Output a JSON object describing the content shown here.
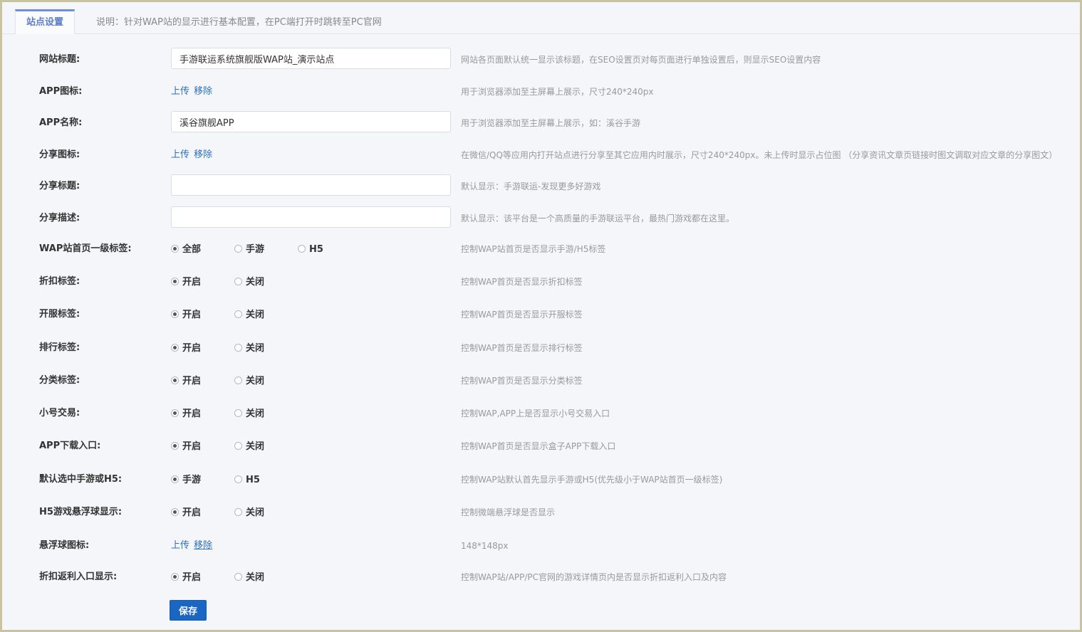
{
  "tab": {
    "label": "站点设置",
    "note": "说明：针对WAP站的显示进行基本配置，在PC端打开时跳转至PC官网"
  },
  "fields": {
    "site_title": {
      "label": "网站标题:",
      "value": "手游联运系统旗舰版WAP站_演示站点",
      "hint": "网站各页面默认统一显示该标题，在SEO设置页对每页面进行单独设置后，则显示SEO设置内容"
    },
    "app_icon": {
      "label": "APP图标:",
      "upload": "上传",
      "remove": "移除",
      "hint": "用于浏览器添加至主屏幕上展示，尺寸240*240px"
    },
    "app_name": {
      "label": "APP名称:",
      "value": "溪谷旗舰APP",
      "hint": "用于浏览器添加至主屏幕上展示，如：溪谷手游"
    },
    "share_icon": {
      "label": "分享图标:",
      "upload": "上传",
      "remove": "移除",
      "hint": "在微信/QQ等应用内打开站点进行分享至其它应用内时展示，尺寸240*240px。未上传时显示占位图 （分享资讯文章页链接时图文调取对应文章的分享图文）"
    },
    "share_title": {
      "label": "分享标题:",
      "value": "",
      "hint": "默认显示：手游联运-发现更多好游戏"
    },
    "share_desc": {
      "label": "分享描述:",
      "value": "",
      "hint": "默认显示：该平台是一个高质量的手游联运平台，最热门游戏都在这里。"
    },
    "wap_top_tab": {
      "label": "WAP站首页一级标签:",
      "options": [
        "全部",
        "手游",
        "H5"
      ],
      "hint": "控制WAP站首页是否显示手游/H5标签"
    },
    "discount_tab": {
      "label": "折扣标签:",
      "options": [
        "开启",
        "关闭"
      ],
      "hint": "控制WAP首页是否显示折扣标签"
    },
    "server_tab": {
      "label": "开服标签:",
      "options": [
        "开启",
        "关闭"
      ],
      "hint": "控制WAP首页是否显示开服标签"
    },
    "rank_tab": {
      "label": "排行标签:",
      "options": [
        "开启",
        "关闭"
      ],
      "hint": "控制WAP首页是否显示排行标签"
    },
    "category_tab": {
      "label": "分类标签:",
      "options": [
        "开启",
        "关闭"
      ],
      "hint": "控制WAP首页是否显示分类标签"
    },
    "account_trade": {
      "label": "小号交易:",
      "options": [
        "开启",
        "关闭"
      ],
      "hint": "控制WAP,APP上是否显示小号交易入口"
    },
    "app_download": {
      "label": "APP下载入口:",
      "options": [
        "开启",
        "关闭"
      ],
      "hint": "控制WAP首页是否显示盒子APP下载入口"
    },
    "default_select": {
      "label": "默认选中手游或H5:",
      "options": [
        "手游",
        "H5"
      ],
      "hint": "控制WAP站默认首先显示手游或H5(优先级小于WAP站首页一级标签)"
    },
    "h5_float_ball": {
      "label": "H5游戏悬浮球显示:",
      "options": [
        "开启",
        "关闭"
      ],
      "hint": "控制微端悬浮球是否显示"
    },
    "float_ball_icon": {
      "label": "悬浮球图标:",
      "upload": "上传",
      "remove": "移除",
      "hint": "148*148px"
    },
    "rebate_entry": {
      "label": "折扣返利入口显示:",
      "options": [
        "开启",
        "关闭"
      ],
      "hint": "控制WAP站/APP/PC官网的游戏详情页内是否显示折扣返利入口及内容"
    }
  },
  "save_label": "保存"
}
